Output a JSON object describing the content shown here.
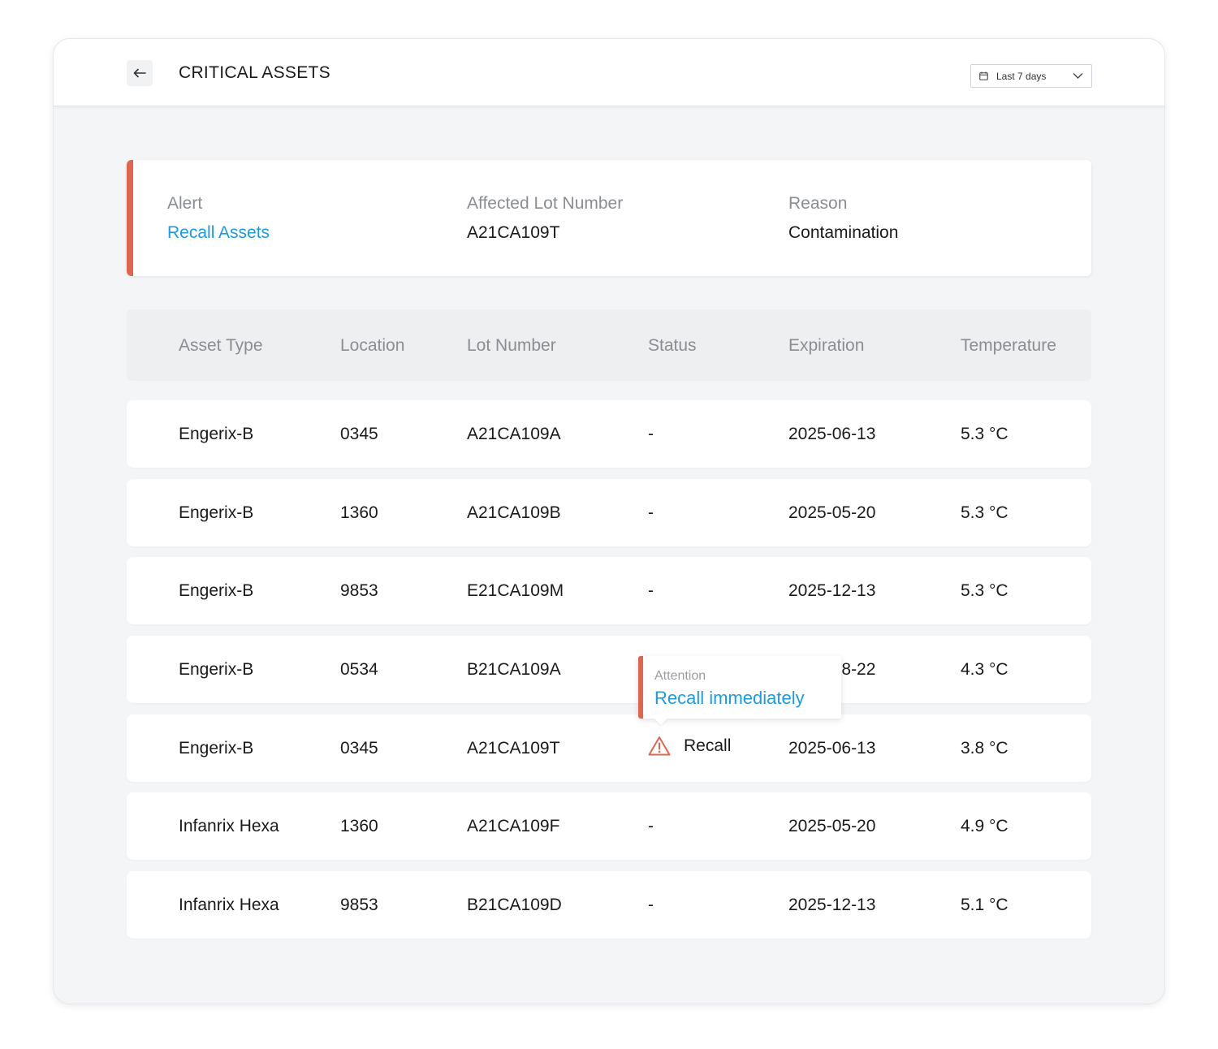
{
  "header": {
    "title": "CRITICAL ASSETS",
    "date_range": "Last 7 days"
  },
  "alert": {
    "alert_label": "Alert",
    "alert_value": "Recall Assets",
    "lot_label": "Affected Lot Number",
    "lot_value": "A21CA109T",
    "reason_label": "Reason",
    "reason_value": "Contamination"
  },
  "table": {
    "columns": [
      "Asset Type",
      "Location",
      "Lot Number",
      "Status",
      "Expiration",
      "Temperature"
    ],
    "rows": [
      {
        "asset": "Engerix-B",
        "location": "0345",
        "lot": "A21CA109A",
        "status": "-",
        "expiration": "2025-06-13",
        "temperature": "5.3 °C"
      },
      {
        "asset": "Engerix-B",
        "location": "1360",
        "lot": "A21CA109B",
        "status": "-",
        "expiration": "2025-05-20",
        "temperature": "5.3 °C"
      },
      {
        "asset": "Engerix-B",
        "location": "9853",
        "lot": "E21CA109M",
        "status": "-",
        "expiration": "2025-12-13",
        "temperature": "5.3 °C"
      },
      {
        "asset": "Engerix-B",
        "location": "0534",
        "lot": "B21CA109A",
        "status": "",
        "expiration": "2025-08-22",
        "temperature": "4.3 °C"
      },
      {
        "asset": "Engerix-B",
        "location": "0345",
        "lot": "A21CA109T",
        "status": "Recall",
        "expiration": "2025-06-13",
        "temperature": "3.8 °C"
      },
      {
        "asset": "Infanrix Hexa",
        "location": "1360",
        "lot": "A21CA109F",
        "status": "-",
        "expiration": "2025-05-20",
        "temperature": "4.9 °C"
      },
      {
        "asset": "Infanrix Hexa",
        "location": "9853",
        "lot": "B21CA109D",
        "status": "-",
        "expiration": "2025-12-13",
        "temperature": "5.1 °C"
      }
    ]
  },
  "tooltip": {
    "label": "Attention",
    "message": "Recall immediately"
  },
  "icons": {
    "back": "arrow-left-icon",
    "calendar": "calendar-icon",
    "dropdown": "chevron-down-icon",
    "warning": "warning-triangle-icon"
  },
  "colors": {
    "alert_accent": "#e0654e",
    "link": "#1a9be6",
    "muted_text": "#8a8d92",
    "background": "#f4f5f7"
  }
}
